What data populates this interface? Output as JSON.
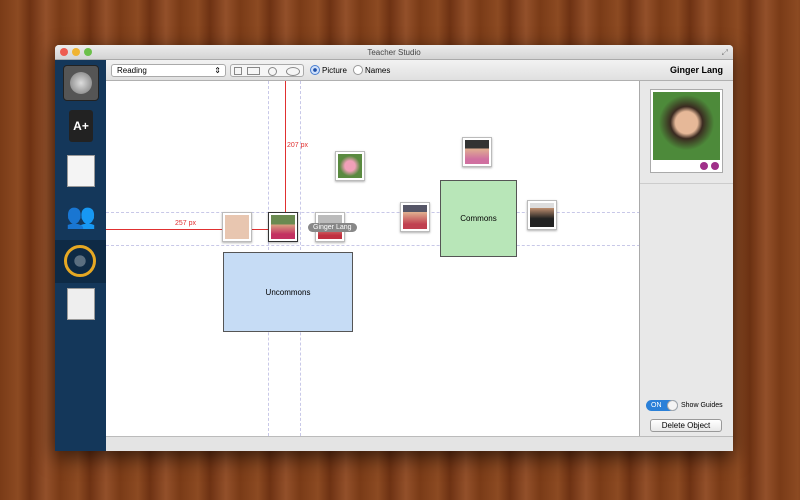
{
  "window": {
    "title": "Teacher Studio"
  },
  "toolbar": {
    "subject": "Reading",
    "view_picture": "Picture",
    "view_names": "Names",
    "selected_view": "Picture",
    "selected_name": "Ginger Lang"
  },
  "sidebar": {
    "items": [
      {
        "name": "settings"
      },
      {
        "name": "gradebook"
      },
      {
        "name": "attendance"
      },
      {
        "name": "students"
      },
      {
        "name": "seating-chart",
        "active": true
      },
      {
        "name": "reports"
      }
    ]
  },
  "canvas": {
    "measure_vertical": "207 px",
    "measure_horizontal": "257 px",
    "tooltip": "Ginger Lang",
    "commons_label": "Commons",
    "uncommons_label": "Uncommons"
  },
  "inspector": {
    "guides_toggle": "ON",
    "guides_label": "Show Guides",
    "delete_button": "Delete Object"
  },
  "colors": {
    "sidebar": "#14375a",
    "commons": "#b8e6b8",
    "uncommons": "#c6dcf5",
    "measure": "#e03030"
  }
}
